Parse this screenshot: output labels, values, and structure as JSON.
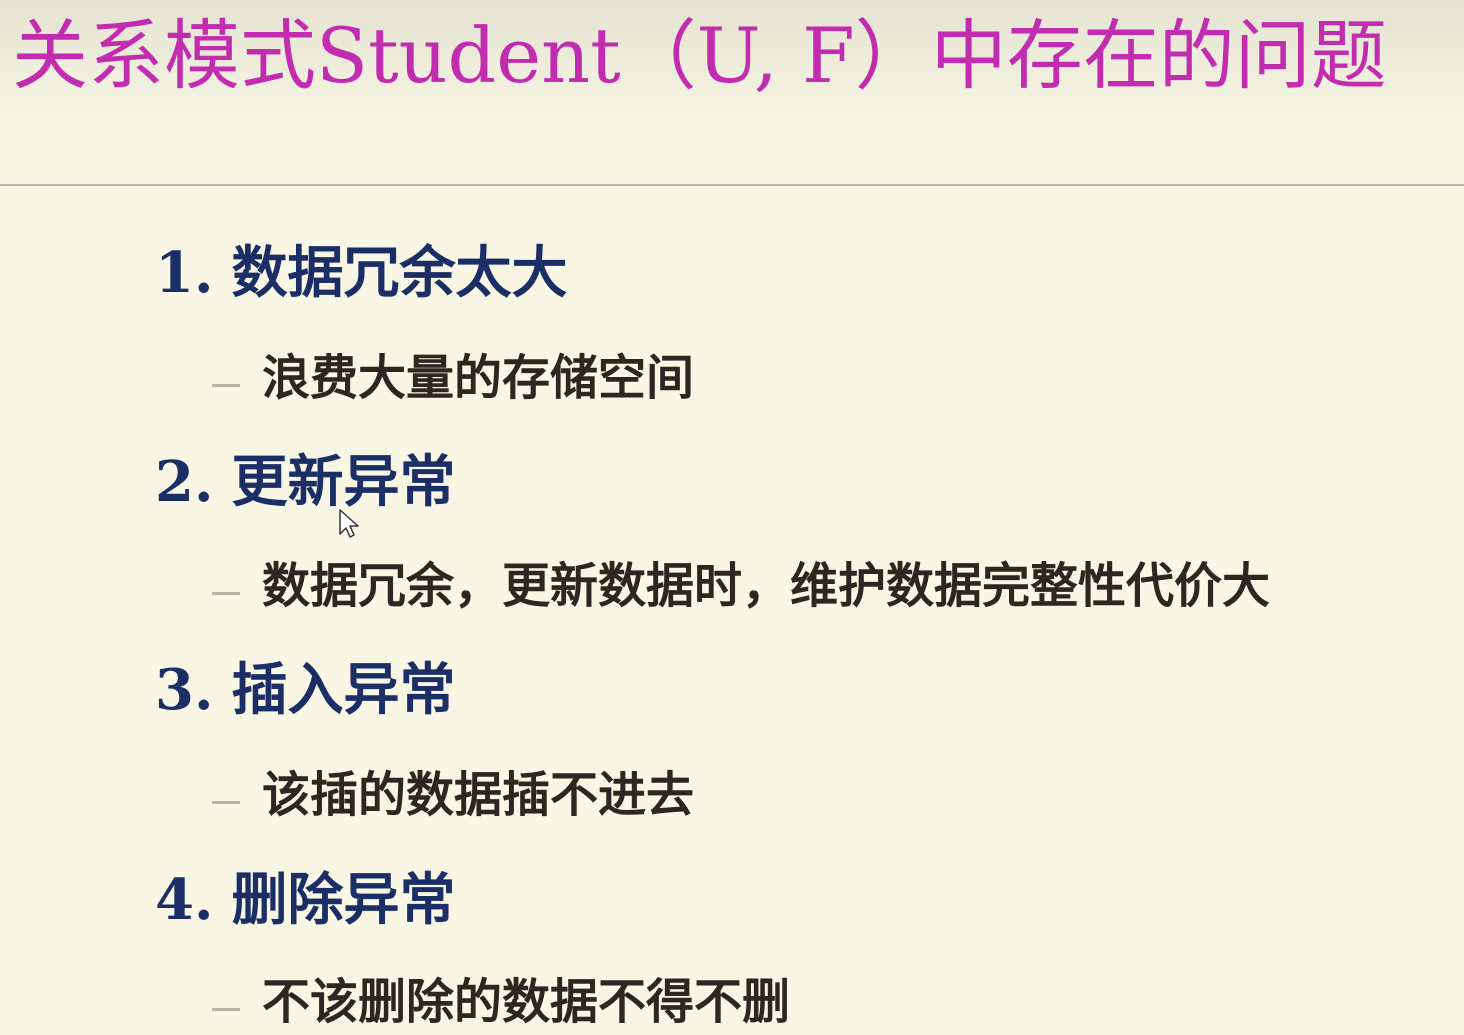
{
  "slide": {
    "title": "关系模式Student（U, F）中存在的问题",
    "items": [
      {
        "number": "1.",
        "heading": "数据冗余太大",
        "detail": "浪费大量的存储空间"
      },
      {
        "number": "2.",
        "heading": "更新异常",
        "detail": "数据冗余，更新数据时，维护数据完整性代价大"
      },
      {
        "number": "3.",
        "heading": "插入异常",
        "detail": "该插的数据插不进去"
      },
      {
        "number": "4.",
        "heading": "删除异常",
        "detail": "不该删除的数据不得不删"
      }
    ]
  },
  "colors": {
    "title": "#c22db0",
    "heading": "#1c2e66",
    "detail": "#2e2620",
    "background": "#f8f6e4"
  },
  "icons": {
    "cursor": "mouse-pointer-icon"
  }
}
